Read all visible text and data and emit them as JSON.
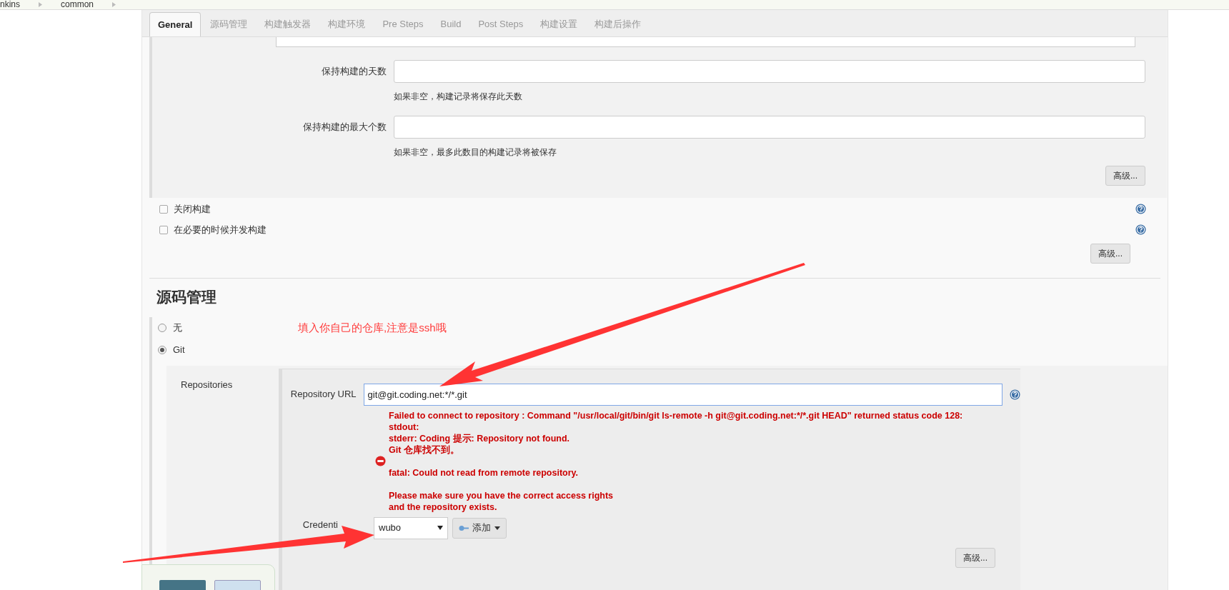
{
  "breadcrumb": [
    "nkins",
    "common"
  ],
  "tabs": [
    {
      "label": "General",
      "selected": true
    },
    {
      "label": "源码管理",
      "selected": false
    },
    {
      "label": "构建触发器",
      "selected": false
    },
    {
      "label": "构建环境",
      "selected": false
    },
    {
      "label": "Pre Steps",
      "selected": false
    },
    {
      "label": "Build",
      "selected": false
    },
    {
      "label": "Post Steps",
      "selected": false
    },
    {
      "label": "构建设置",
      "selected": false
    },
    {
      "label": "构建后操作",
      "selected": false
    }
  ],
  "log_rotation": {
    "fields": [
      {
        "label": "保持构建的天数",
        "help": "如果非空，构建记录将保存此天数"
      },
      {
        "label": "保持构建的最大个数",
        "help": "如果非空，最多此数目的构建记录将被保存"
      }
    ],
    "advanced_button": "高级..."
  },
  "options": [
    {
      "label": "关闭构建",
      "checked": false
    },
    {
      "label": "在必要的时候并发构建",
      "checked": false
    }
  ],
  "advanced_button": "高级...",
  "scm": {
    "title": "源码管理",
    "annotation": "填入你自己的仓库,注意是ssh哦",
    "choices": [
      {
        "label": "无",
        "selected": false
      },
      {
        "label": "Git",
        "selected": true
      }
    ],
    "repositories_label": "Repositories",
    "url_label": "Repository URL",
    "url_value": "git@git.coding.net:*/*.git",
    "error": "Failed to connect to repository : Command \"/usr/local/git/bin/git ls-remote -h git@git.coding.net:*/*.git HEAD\" returned status code 128:\nstdout:\nstderr: Coding 提示: Repository not found.\nGit 仓库找不到。\n\nfatal: Could not read from remote repository.\n\nPlease make sure you have the correct access rights\nand the repository exists.",
    "credentials_label": "Credenti",
    "credentials_value": "wubo",
    "add_button": "添加",
    "advanced_button": "高级..."
  }
}
